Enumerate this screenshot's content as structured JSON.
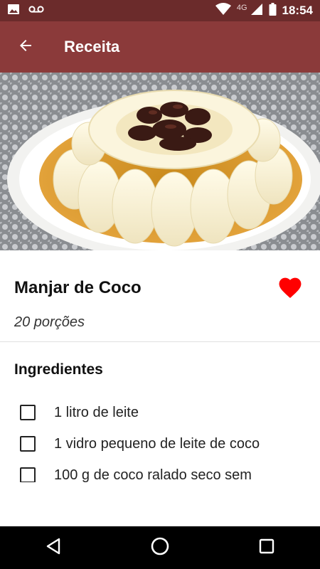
{
  "status_bar": {
    "time": "18:54",
    "network_type": "4G",
    "icons": [
      "image-icon",
      "voicemail-icon",
      "wifi-icon",
      "signal-icon",
      "battery-icon"
    ]
  },
  "app_bar": {
    "title": "Receita",
    "back_icon": "arrow-back-icon",
    "color": "#8b3a3a"
  },
  "recipe": {
    "title": "Manjar de Coco",
    "servings": "20 porções",
    "favorite": true,
    "favorite_color": "#ff0000",
    "image_description_icon": "recipe-photo"
  },
  "ingredients_section": {
    "title": "Ingredientes",
    "items": [
      {
        "label": "1 litro de leite",
        "checked": false
      },
      {
        "label": "1 vidro pequeno de leite de coco",
        "checked": false
      },
      {
        "label": "100 g de coco ralado seco sem",
        "checked": false
      }
    ]
  },
  "nav_bar": {
    "icons": [
      "nav-back-icon",
      "nav-home-icon",
      "nav-recents-icon"
    ]
  }
}
